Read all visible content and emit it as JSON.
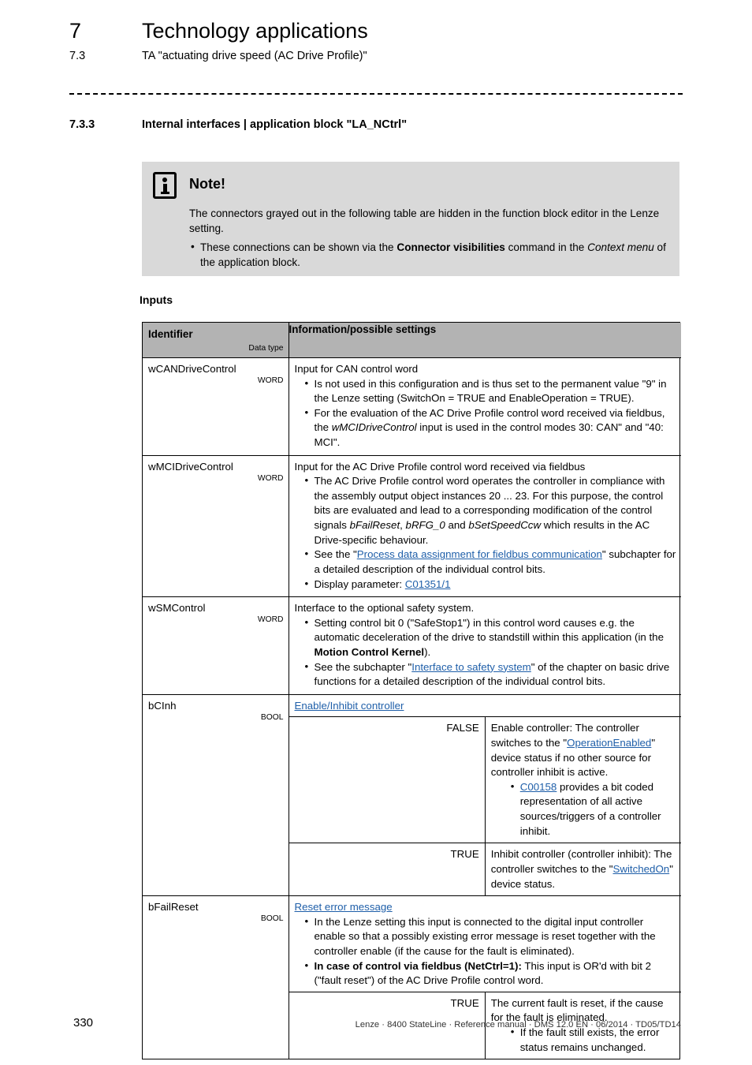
{
  "header": {
    "chapter_number": "7",
    "chapter_title": "Technology applications",
    "section_number": "7.3",
    "section_title": "TA \"actuating drive speed (AC Drive Profile)\""
  },
  "section_heading": {
    "number": "7.3.3",
    "title": "Internal interfaces | application block \"LA_NCtrl\""
  },
  "note": {
    "icon": "info-icon",
    "title": "Note!",
    "paragraph": "The connectors grayed out in the following table are hidden in the function block editor in the Lenze setting.",
    "bullet_1_pre": "These connections can be shown via the ",
    "bullet_1_bold": "Connector visibilities",
    "bullet_1_mid": " command in the ",
    "bullet_1_italic": "Context menu",
    "bullet_1_post": " of the application block.",
    "background_color": "#d9d9d9"
  },
  "table_caption": "Inputs",
  "table": {
    "header": {
      "col_identifier": "Identifier",
      "col_data_type": "Data type",
      "col_information": "Information/possible settings",
      "background_color": "#b3b3b3"
    },
    "link_color": "#1f5fa9",
    "rows": [
      {
        "identifier": "wCANDriveControl",
        "data_type": "WORD",
        "lead": "Input for CAN control word",
        "bullets": [
          {
            "parts": [
              {
                "t": "Is not used in this configuration and is thus set to the permanent value \"9\" in the Lenze setting (SwitchOn = TRUE and EnableOperation = TRUE).",
                "s": "n"
              }
            ]
          },
          {
            "parts": [
              {
                "t": "For the evaluation of the AC Drive Profile control word received via fieldbus, the ",
                "s": "n"
              },
              {
                "t": "wMCIDriveControl",
                "s": "i"
              },
              {
                "t": " input is used in the control modes 30: CAN\" and \"40: MCI\".",
                "s": "n"
              }
            ]
          }
        ]
      },
      {
        "identifier": "wMCIDriveControl",
        "data_type": "WORD",
        "lead": "Input for the AC Drive Profile control word received via fieldbus",
        "bullets": [
          {
            "parts": [
              {
                "t": "The AC Drive Profile control word operates the controller in compliance with the assembly output object instances 20 ... 23. For this purpose, the control bits are evaluated and lead to a corresponding modification of the control signals ",
                "s": "n"
              },
              {
                "t": "bFailReset",
                "s": "i"
              },
              {
                "t": ", ",
                "s": "n"
              },
              {
                "t": "bRFG_0",
                "s": "i"
              },
              {
                "t": " and ",
                "s": "n"
              },
              {
                "t": "bSetSpeedCcw",
                "s": "i"
              },
              {
                "t": " which results in the AC Drive-specific behaviour.",
                "s": "n"
              }
            ]
          },
          {
            "parts": [
              {
                "t": "See the \"",
                "s": "n"
              },
              {
                "t": "Process data assignment for fieldbus communication",
                "s": "l"
              },
              {
                "t": "\" subchapter for a detailed description of the individual control bits.",
                "s": "n"
              }
            ]
          },
          {
            "parts": [
              {
                "t": "Display parameter: ",
                "s": "n"
              },
              {
                "t": "C01351/1",
                "s": "l"
              }
            ]
          }
        ]
      },
      {
        "identifier": "wSMControl",
        "data_type": "WORD",
        "lead": "Interface to the optional safety system.",
        "bullets": [
          {
            "parts": [
              {
                "t": "Setting control bit 0 (\"SafeStop1\") in this control word causes e.g. the automatic deceleration of the drive to standstill within this application (in the ",
                "s": "n"
              },
              {
                "t": "Motion Control Kernel",
                "s": "b"
              },
              {
                "t": ").",
                "s": "n"
              }
            ]
          },
          {
            "parts": [
              {
                "t": "See the subchapter \"",
                "s": "n"
              },
              {
                "t": "Interface to safety system",
                "s": "l"
              },
              {
                "t": "\" of the chapter on basic drive functions for a detailed description of the individual control bits.",
                "s": "n"
              }
            ]
          }
        ]
      },
      {
        "identifier": "bCInh",
        "data_type": "BOOL",
        "sub_heading_link": "Enable/Inhibit controller",
        "values": [
          {
            "value": "FALSE",
            "parts": [
              {
                "t": "Enable controller: The controller switches to the \"",
                "s": "n"
              },
              {
                "t": "OperationEnabled",
                "s": "l"
              },
              {
                "t": "\" device status if no other source for controller inhibit is active.",
                "s": "n"
              }
            ],
            "bullets": [
              {
                "parts": [
                  {
                    "t": "C00158",
                    "s": "l"
                  },
                  {
                    "t": " provides a bit coded representation of all active sources/triggers of a controller inhibit.",
                    "s": "n"
                  }
                ]
              }
            ]
          },
          {
            "value": "TRUE",
            "parts": [
              {
                "t": "Inhibit controller (controller inhibit): The controller switches to the \"",
                "s": "n"
              },
              {
                "t": "SwitchedOn",
                "s": "l"
              },
              {
                "t": "\" device status.",
                "s": "n"
              }
            ],
            "bullets": []
          }
        ]
      },
      {
        "identifier": "bFailReset",
        "data_type": "BOOL",
        "sub_heading_link": "Reset error message",
        "top_bullets": [
          {
            "parts": [
              {
                "t": "In the Lenze setting this input is connected to the digital input controller enable so that a possibly existing error message is reset together with the controller enable (if the cause for the fault is eliminated).",
                "s": "n"
              }
            ]
          },
          {
            "parts": [
              {
                "t": "In case of control via fieldbus (NetCtrl=1):",
                "s": "b"
              },
              {
                "t": " This input is OR'd with bit 2 (\"fault reset\") of the AC Drive Profile control word.",
                "s": "n"
              }
            ]
          }
        ],
        "values": [
          {
            "value": "TRUE",
            "parts": [
              {
                "t": "The current fault is reset, if the cause for the fault is eliminated.",
                "s": "n"
              }
            ],
            "bullets": [
              {
                "parts": [
                  {
                    "t": "If the fault still exists, the error status remains unchanged.",
                    "s": "n"
                  }
                ]
              }
            ]
          }
        ]
      }
    ]
  },
  "footer": {
    "page_number": "330",
    "text": "Lenze · 8400 StateLine · Reference manual · DMS 12.0 EN · 06/2014 · TD05/TD14"
  }
}
